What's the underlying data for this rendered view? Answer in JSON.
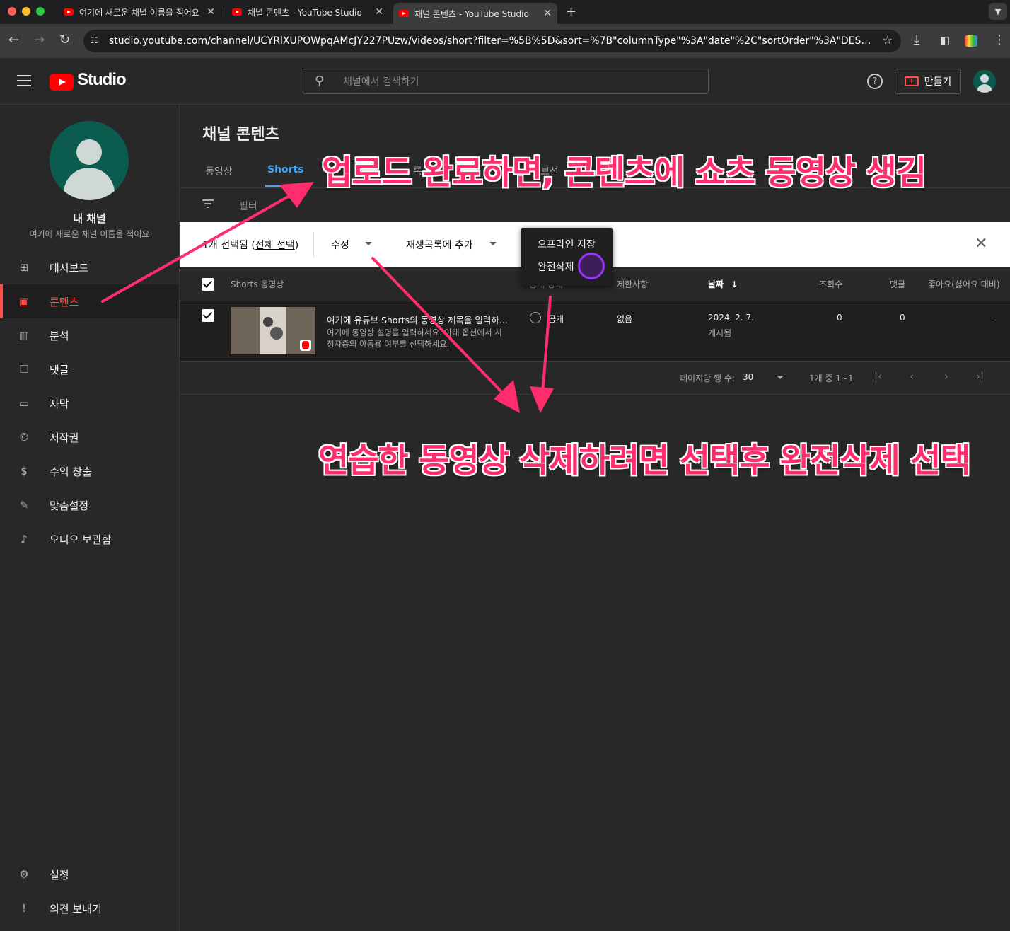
{
  "browser": {
    "tabs": [
      {
        "label": "여기에 새로운 채널 이름을 적어요 -"
      },
      {
        "label": "채널 콘텐츠 - YouTube Studio"
      },
      {
        "label": "채널 콘텐츠 - YouTube Studio"
      }
    ],
    "url": "studio.youtube.com/channel/UCYRlXUPOWpqAMcJY227PUzw/videos/short?filter=%5B%5D&sort=%7B\"columnType\"%3A\"date\"%2C\"sortOrder\"%3A\"DESCENDIN..."
  },
  "header": {
    "logo_text": "Studio",
    "search_placeholder": "채널에서 검색하기",
    "create_label": "만들기"
  },
  "channel": {
    "title": "내 채널",
    "name": "여기에 새로운 채널 이름을 적어요"
  },
  "sidebar": {
    "items": [
      {
        "label": "대시보드",
        "icon": "dashboard-icon"
      },
      {
        "label": "콘텐츠",
        "icon": "content-icon"
      },
      {
        "label": "분석",
        "icon": "analytics-icon"
      },
      {
        "label": "댓글",
        "icon": "comments-icon"
      },
      {
        "label": "자막",
        "icon": "subtitles-icon"
      },
      {
        "label": "저작권",
        "icon": "copyright-icon"
      },
      {
        "label": "수익 창출",
        "icon": "monetization-icon"
      },
      {
        "label": "맞춤설정",
        "icon": "customization-icon"
      },
      {
        "label": "오디오 보관함",
        "icon": "audio-library-icon"
      }
    ],
    "bottom": [
      {
        "label": "설정",
        "icon": "settings-icon"
      },
      {
        "label": "의견 보내기",
        "icon": "feedback-icon"
      }
    ]
  },
  "main": {
    "page_title": "채널 콘텐츠",
    "tabs": [
      {
        "label": "동영상"
      },
      {
        "label": "Shorts"
      },
      {
        "label": "록"
      },
      {
        "label": "보선"
      }
    ],
    "filter_label": "필터",
    "selection": {
      "count_prefix": "1개 선택됨 (",
      "select_all": "전체 선택",
      "count_suffix": ")",
      "edit_label": "수정",
      "add_playlist_label": "재생목록에 추가"
    },
    "menu": {
      "offline_save": "오프라인 저장",
      "delete_forever": "완전삭제"
    },
    "table": {
      "headers": {
        "video": "Shorts 동영상",
        "visibility": "공개 상태",
        "restrictions": "제한사항",
        "date": "날짜",
        "views": "조회수",
        "comments": "댓글",
        "likes": "좋아요(싫어요 대비)"
      },
      "row": {
        "title": "여기에 유튜브 Shorts의 동영상 제목을 입력하...",
        "desc1": "여기에 동영상 설명을 입력하세요. 아래 옵션에서 시",
        "desc2": "청자층의 아동용 여부를 선택하세요.",
        "visibility": "공개",
        "restrictions": "없음",
        "date": "2024. 2. 7.",
        "date_status": "게시됨",
        "views": "0",
        "comments": "0",
        "likes": "–"
      }
    },
    "pagination": {
      "rows_label": "페이지당 행 수:",
      "rows_value": "30",
      "range": "1개 중 1~1"
    }
  },
  "annotations": {
    "top": "업로드 완료하면, 콘텐츠에 쇼츠 동영상 생김",
    "bottom": "연습한 동영상 삭제하려면 선택후 완전삭제 선택"
  },
  "colors": {
    "accent": "#ff4e45",
    "annotation": "#ff2d6b",
    "tab_active": "#3ea6ff",
    "highlight_circle": "#9b30ff"
  }
}
